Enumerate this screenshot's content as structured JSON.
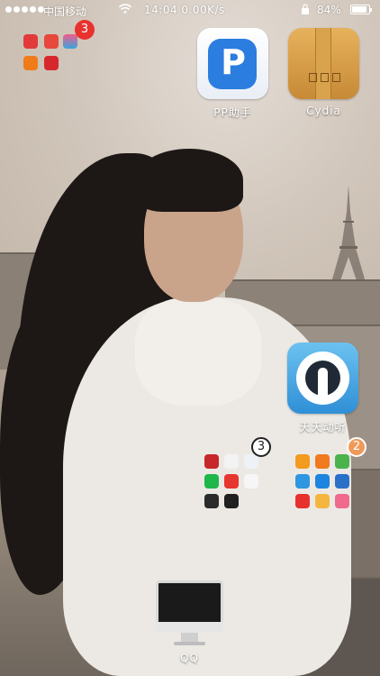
{
  "status_bar": {
    "carrier": "中国移动",
    "time_speed": "14:04 0.00K/s",
    "battery_percent": "84%",
    "battery_level": 0.84
  },
  "apps": {
    "pp": {
      "label": "PP助手",
      "icon": "pp-assistant-icon",
      "color": "#2b7de0"
    },
    "cydia": {
      "label": "Cydia",
      "icon": "cydia-box-icon",
      "color": "#c8903e"
    },
    "ttpod": {
      "label": "天天动听",
      "icon": "ttpod-icon",
      "color": "#3fa0e0"
    },
    "qq": {
      "label": "QQ",
      "icon": "imac-icon"
    }
  },
  "folders": {
    "top_left": {
      "badge": "3",
      "badge_color": "#e8322e"
    },
    "middle": {
      "badge": "3",
      "badge_color": "#ffffff"
    },
    "right": {
      "badge": "2",
      "badge_color": "#f09a5a"
    }
  }
}
